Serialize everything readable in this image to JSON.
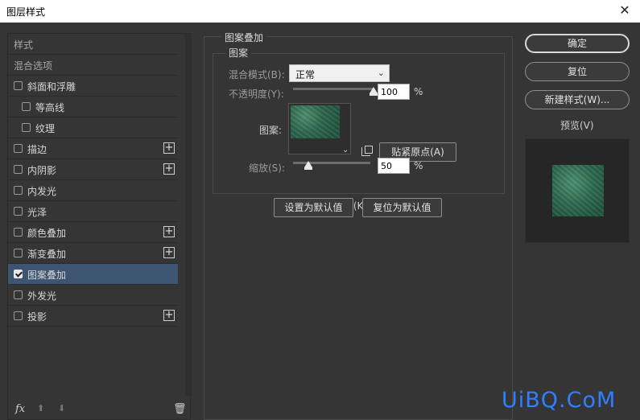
{
  "window": {
    "title": "图层样式",
    "close_glyph": "✕"
  },
  "styles_list": {
    "header": "样式",
    "blend_options": "混合选项",
    "items": [
      {
        "label": "斜面和浮雕",
        "checked": false,
        "has_plus": false,
        "indent": false
      },
      {
        "label": "等高线",
        "checked": false,
        "has_plus": false,
        "indent": true
      },
      {
        "label": "纹理",
        "checked": false,
        "has_plus": false,
        "indent": true
      },
      {
        "label": "描边",
        "checked": false,
        "has_plus": true,
        "indent": false
      },
      {
        "label": "内阴影",
        "checked": false,
        "has_plus": true,
        "indent": false
      },
      {
        "label": "内发光",
        "checked": false,
        "has_plus": false,
        "indent": false
      },
      {
        "label": "光泽",
        "checked": false,
        "has_plus": false,
        "indent": false
      },
      {
        "label": "颜色叠加",
        "checked": false,
        "has_plus": true,
        "indent": false
      },
      {
        "label": "渐变叠加",
        "checked": false,
        "has_plus": true,
        "indent": false
      },
      {
        "label": "图案叠加",
        "checked": true,
        "has_plus": false,
        "indent": false,
        "selected": true
      },
      {
        "label": "外发光",
        "checked": false,
        "has_plus": false,
        "indent": false
      },
      {
        "label": "投影",
        "checked": false,
        "has_plus": true,
        "indent": false
      }
    ],
    "bottom": {
      "fx_label": "fx",
      "up_icon": "arrow-up-icon",
      "down_icon": "arrow-down-icon",
      "trash_icon": "trash-icon"
    }
  },
  "pattern_overlay": {
    "section_title": "图案叠加",
    "group_title": "图案",
    "blend_mode_label": "混合模式(B):",
    "blend_mode_value": "正常",
    "opacity_label": "不透明度(Y):",
    "opacity_value": "100",
    "opacity_fraction": 1.0,
    "pattern_label": "图案:",
    "snap_button": "贴紧原点(A)",
    "scale_label": "缩放(S):",
    "scale_value": "50",
    "scale_fraction": 0.2,
    "percent": "%",
    "link_label": "与图层链接 (K)",
    "link_checked": true,
    "set_default": "设置为默认值",
    "reset_default": "复位为默认值"
  },
  "right": {
    "ok": "确定",
    "reset": "复位",
    "new_style": "新建样式(W)...",
    "preview_label": "预览(V)",
    "preview_checked": true
  },
  "watermark": "UiBQ.CoM",
  "colors": {
    "accent_selected": "#3d5570",
    "pattern_green": "#2e6a4f",
    "watermark": "#2f7fff"
  }
}
